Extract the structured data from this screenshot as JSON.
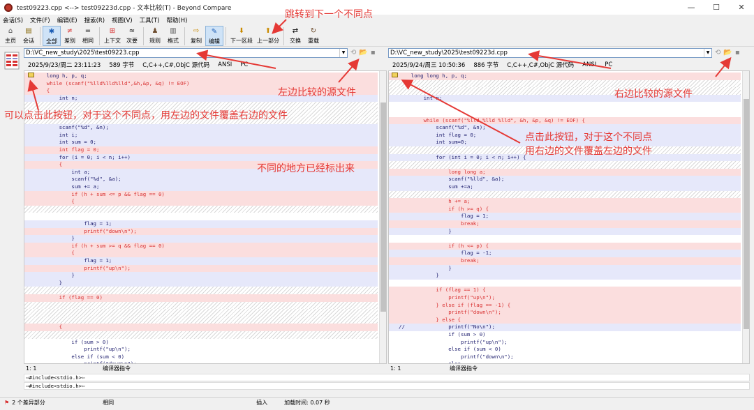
{
  "window": {
    "title": "test09223.cpp <--> test09223d.cpp - 文本比较(T) - Beyond Compare",
    "min": "—",
    "max": "☐",
    "close": "✕"
  },
  "menu": [
    "会话(S)",
    "文件(F)",
    "编辑(E)",
    "搜索(R)",
    "视图(V)",
    "工具(T)",
    "帮助(H)"
  ],
  "toolbar": [
    {
      "label": "主页",
      "icon": "⌂"
    },
    {
      "label": "会话",
      "icon": "▤"
    },
    {
      "label": "全部",
      "icon": "✱"
    },
    {
      "label": "差别",
      "icon": "≠"
    },
    {
      "label": "相同",
      "icon": "="
    },
    {
      "label": "上下文",
      "icon": "⊞"
    },
    {
      "label": "次要",
      "icon": "≈"
    },
    {
      "label": "规则",
      "icon": "♟"
    },
    {
      "label": "格式",
      "icon": "▥"
    },
    {
      "label": "复制",
      "icon": "⇨"
    },
    {
      "label": "编辑",
      "icon": "✎"
    },
    {
      "label": "下一区段",
      "icon": "⬇"
    },
    {
      "label": "上一部分",
      "icon": "⬆"
    },
    {
      "label": "交换",
      "icon": "⇄"
    },
    {
      "label": "重载",
      "icon": "↻"
    }
  ],
  "left": {
    "path": "D:\\VC_new_study\\2025\\test09223.cpp",
    "date": "2025/9/23/周二 23:11:23",
    "size": "589 字节",
    "lang": "C,C++,C#,ObjC 源代码",
    "enc": "ANSI",
    "eol": "PC",
    "pos": "1: 1",
    "mode": "编译器指令"
  },
  "right": {
    "path": "D:\\VC_new_study\\2025\\test09223d.cpp",
    "date": "2025/9/24/周三 10:50:36",
    "size": "886 字节",
    "lang": "C,C++,C#,ObjC 源代码",
    "enc": "ANSI",
    "eol": "PC",
    "pos": "1: 1",
    "mode": "编译器指令"
  },
  "left_lines": [
    {
      "t": "    long h, p, q;",
      "s": "pink",
      "c": "blk"
    },
    {
      "t": "    while (scanf(\"%lld%lld%lld\",&h,&p, &q) != EOF)",
      "s": "pink",
      "c": "red"
    },
    {
      "t": "    {",
      "s": "pink",
      "c": "red"
    },
    {
      "t": "        int n;",
      "s": "blue",
      "c": "blk"
    },
    {
      "t": "",
      "s": "hatch",
      "c": "blk"
    },
    {
      "t": "",
      "s": "hatch",
      "c": "blk"
    },
    {
      "t": "",
      "s": "hatch",
      "c": "blk"
    },
    {
      "t": "        scanf(\"%d\", &n);",
      "s": "blue",
      "c": "blk"
    },
    {
      "t": "        int i;",
      "s": "blue",
      "c": "blk"
    },
    {
      "t": "        int sum = 0;",
      "s": "blue",
      "c": "blk"
    },
    {
      "t": "        int flag = 0;",
      "s": "pink",
      "c": "red"
    },
    {
      "t": "        for (i = 0; i < n; i++)",
      "s": "blue",
      "c": "blk"
    },
    {
      "t": "        {",
      "s": "pink",
      "c": "red"
    },
    {
      "t": "            int a;",
      "s": "blue",
      "c": "blk"
    },
    {
      "t": "            scanf(\"%d\", &a);",
      "s": "blue",
      "c": "blk"
    },
    {
      "t": "            sum += a;",
      "s": "blue",
      "c": "blk"
    },
    {
      "t": "            if (h + sum <= p && flag == 0)",
      "s": "pink",
      "c": "red"
    },
    {
      "t": "            {",
      "s": "pink",
      "c": "red"
    },
    {
      "t": "",
      "s": "hatch",
      "c": "blk"
    },
    {
      "t": "",
      "s": "white",
      "c": "blk"
    },
    {
      "t": "                flag = 1;",
      "s": "blue",
      "c": "blk"
    },
    {
      "t": "                printf(\"down\\n\");",
      "s": "pink",
      "c": "red"
    },
    {
      "t": "            }",
      "s": "blue",
      "c": "blk"
    },
    {
      "t": "            if (h + sum >= q && flag == 0)",
      "s": "pink",
      "c": "red"
    },
    {
      "t": "            {",
      "s": "pink",
      "c": "red"
    },
    {
      "t": "                flag = 1;",
      "s": "blue",
      "c": "blk"
    },
    {
      "t": "                printf(\"up\\n\");",
      "s": "pink",
      "c": "red"
    },
    {
      "t": "            }",
      "s": "blue",
      "c": "blk"
    },
    {
      "t": "        }",
      "s": "blue",
      "c": "blk"
    },
    {
      "t": "",
      "s": "hatch",
      "c": "blk"
    },
    {
      "t": "        if (flag == 0)",
      "s": "pink",
      "c": "red"
    },
    {
      "t": "",
      "s": "hatch",
      "c": "blk"
    },
    {
      "t": "",
      "s": "hatch",
      "c": "blk"
    },
    {
      "t": "",
      "s": "hatch",
      "c": "blk"
    },
    {
      "t": "        {",
      "s": "pink",
      "c": "red"
    },
    {
      "t": "",
      "s": "hatch",
      "c": "blk"
    },
    {
      "t": "            if (sum > 0)",
      "s": "white",
      "c": "blk"
    },
    {
      "t": "                printf(\"up\\n\");",
      "s": "white",
      "c": "blk"
    },
    {
      "t": "            else if (sum < 0)",
      "s": "white",
      "c": "blk"
    },
    {
      "t": "                printf(\"down\\n\");",
      "s": "white",
      "c": "blk"
    },
    {
      "t": "            else",
      "s": "white",
      "c": "blk"
    }
  ],
  "right_lines": [
    {
      "t": "    long long h, p, q;",
      "s": "pink",
      "c": "blk"
    },
    {
      "t": "",
      "s": "hatch",
      "c": "blk"
    },
    {
      "t": "",
      "s": "hatch",
      "c": "blk"
    },
    {
      "t": "        int n;",
      "s": "blue",
      "c": "blk"
    },
    {
      "t": "",
      "s": "white",
      "c": "blk"
    },
    {
      "t": "",
      "s": "white",
      "c": "blk"
    },
    {
      "t": "        while (scanf(\"%lld %lld %lld\", &h, &p, &q) != EOF) {",
      "s": "pink",
      "c": "red"
    },
    {
      "t": "            scanf(\"%d\", &n);",
      "s": "blue",
      "c": "blk"
    },
    {
      "t": "            int flag = 0;",
      "s": "blue",
      "c": "blk"
    },
    {
      "t": "            int sum=0;",
      "s": "blue",
      "c": "blk"
    },
    {
      "t": "",
      "s": "hatch",
      "c": "blk"
    },
    {
      "t": "            for (int i = 0; i < n; i++) {",
      "s": "blue",
      "c": "blk"
    },
    {
      "t": "",
      "s": "hatch",
      "c": "blk"
    },
    {
      "t": "                long long a;",
      "s": "pink",
      "c": "red"
    },
    {
      "t": "                scanf(\"%lld\", &a);",
      "s": "blue",
      "c": "blk"
    },
    {
      "t": "                sum +=a;",
      "s": "blue",
      "c": "blk"
    },
    {
      "t": "",
      "s": "hatch",
      "c": "blk"
    },
    {
      "t": "                h += a;",
      "s": "pink",
      "c": "red"
    },
    {
      "t": "                if (h >= q) {",
      "s": "pink",
      "c": "red"
    },
    {
      "t": "                    flag = 1;",
      "s": "blue",
      "c": "blk"
    },
    {
      "t": "                    break;",
      "s": "pink",
      "c": "red"
    },
    {
      "t": "                }",
      "s": "blue",
      "c": "blk"
    },
    {
      "t": "",
      "s": "white",
      "c": "blk"
    },
    {
      "t": "                if (h <= p) {",
      "s": "pink",
      "c": "red"
    },
    {
      "t": "                    flag = -1;",
      "s": "blue",
      "c": "blk"
    },
    {
      "t": "                    break;",
      "s": "pink",
      "c": "red"
    },
    {
      "t": "                }",
      "s": "blue",
      "c": "blk"
    },
    {
      "t": "            }",
      "s": "blue",
      "c": "blk"
    },
    {
      "t": "",
      "s": "white",
      "c": "blk"
    },
    {
      "t": "            if (flag == 1) {",
      "s": "pink",
      "c": "red"
    },
    {
      "t": "                printf(\"up\\n\");",
      "s": "pink",
      "c": "red"
    },
    {
      "t": "            } else if (flag == -1) {",
      "s": "pink",
      "c": "red"
    },
    {
      "t": "                printf(\"down\\n\");",
      "s": "pink",
      "c": "red"
    },
    {
      "t": "            } else {",
      "s": "pink",
      "c": "red"
    },
    {
      "t": "//              printf(\"No\\n\");",
      "s": "blue",
      "c": "blk"
    },
    {
      "t": "                if (sum > 0)",
      "s": "white",
      "c": "blk"
    },
    {
      "t": "                    printf(\"up\\n\");",
      "s": "white",
      "c": "blk"
    },
    {
      "t": "                else if (sum < 0)",
      "s": "white",
      "c": "blk"
    },
    {
      "t": "                    printf(\"down\\n\");",
      "s": "white",
      "c": "blk"
    },
    {
      "t": "                else",
      "s": "white",
      "c": "blk"
    }
  ],
  "bottom": {
    "line1": "⇨#include<stdio.h>⇦",
    "line2": "⇨#include<stdio.h>⇦"
  },
  "status": {
    "diffs": "2 个差异部分",
    "same": "相同",
    "insert": "插入",
    "load": "加载时间: 0.07 秒"
  },
  "annotations": {
    "next_diff": "跳转到下一个不同点",
    "left_src": "左边比较的源文件",
    "right_src": "右边比较的源文件",
    "left_btn": "可以点击此按钮，对于这个不同点，用左边的文件覆盖右边的文件",
    "right_btn1": "点击此按钮，对于这个不同点",
    "right_btn2": "用右边的文件覆盖左边的文件",
    "marked": "不同的地方已经标出来"
  },
  "colors": {
    "diff_bg": "#fbdede",
    "minor_bg": "#e6e8fa",
    "annotation": "#e53935"
  }
}
